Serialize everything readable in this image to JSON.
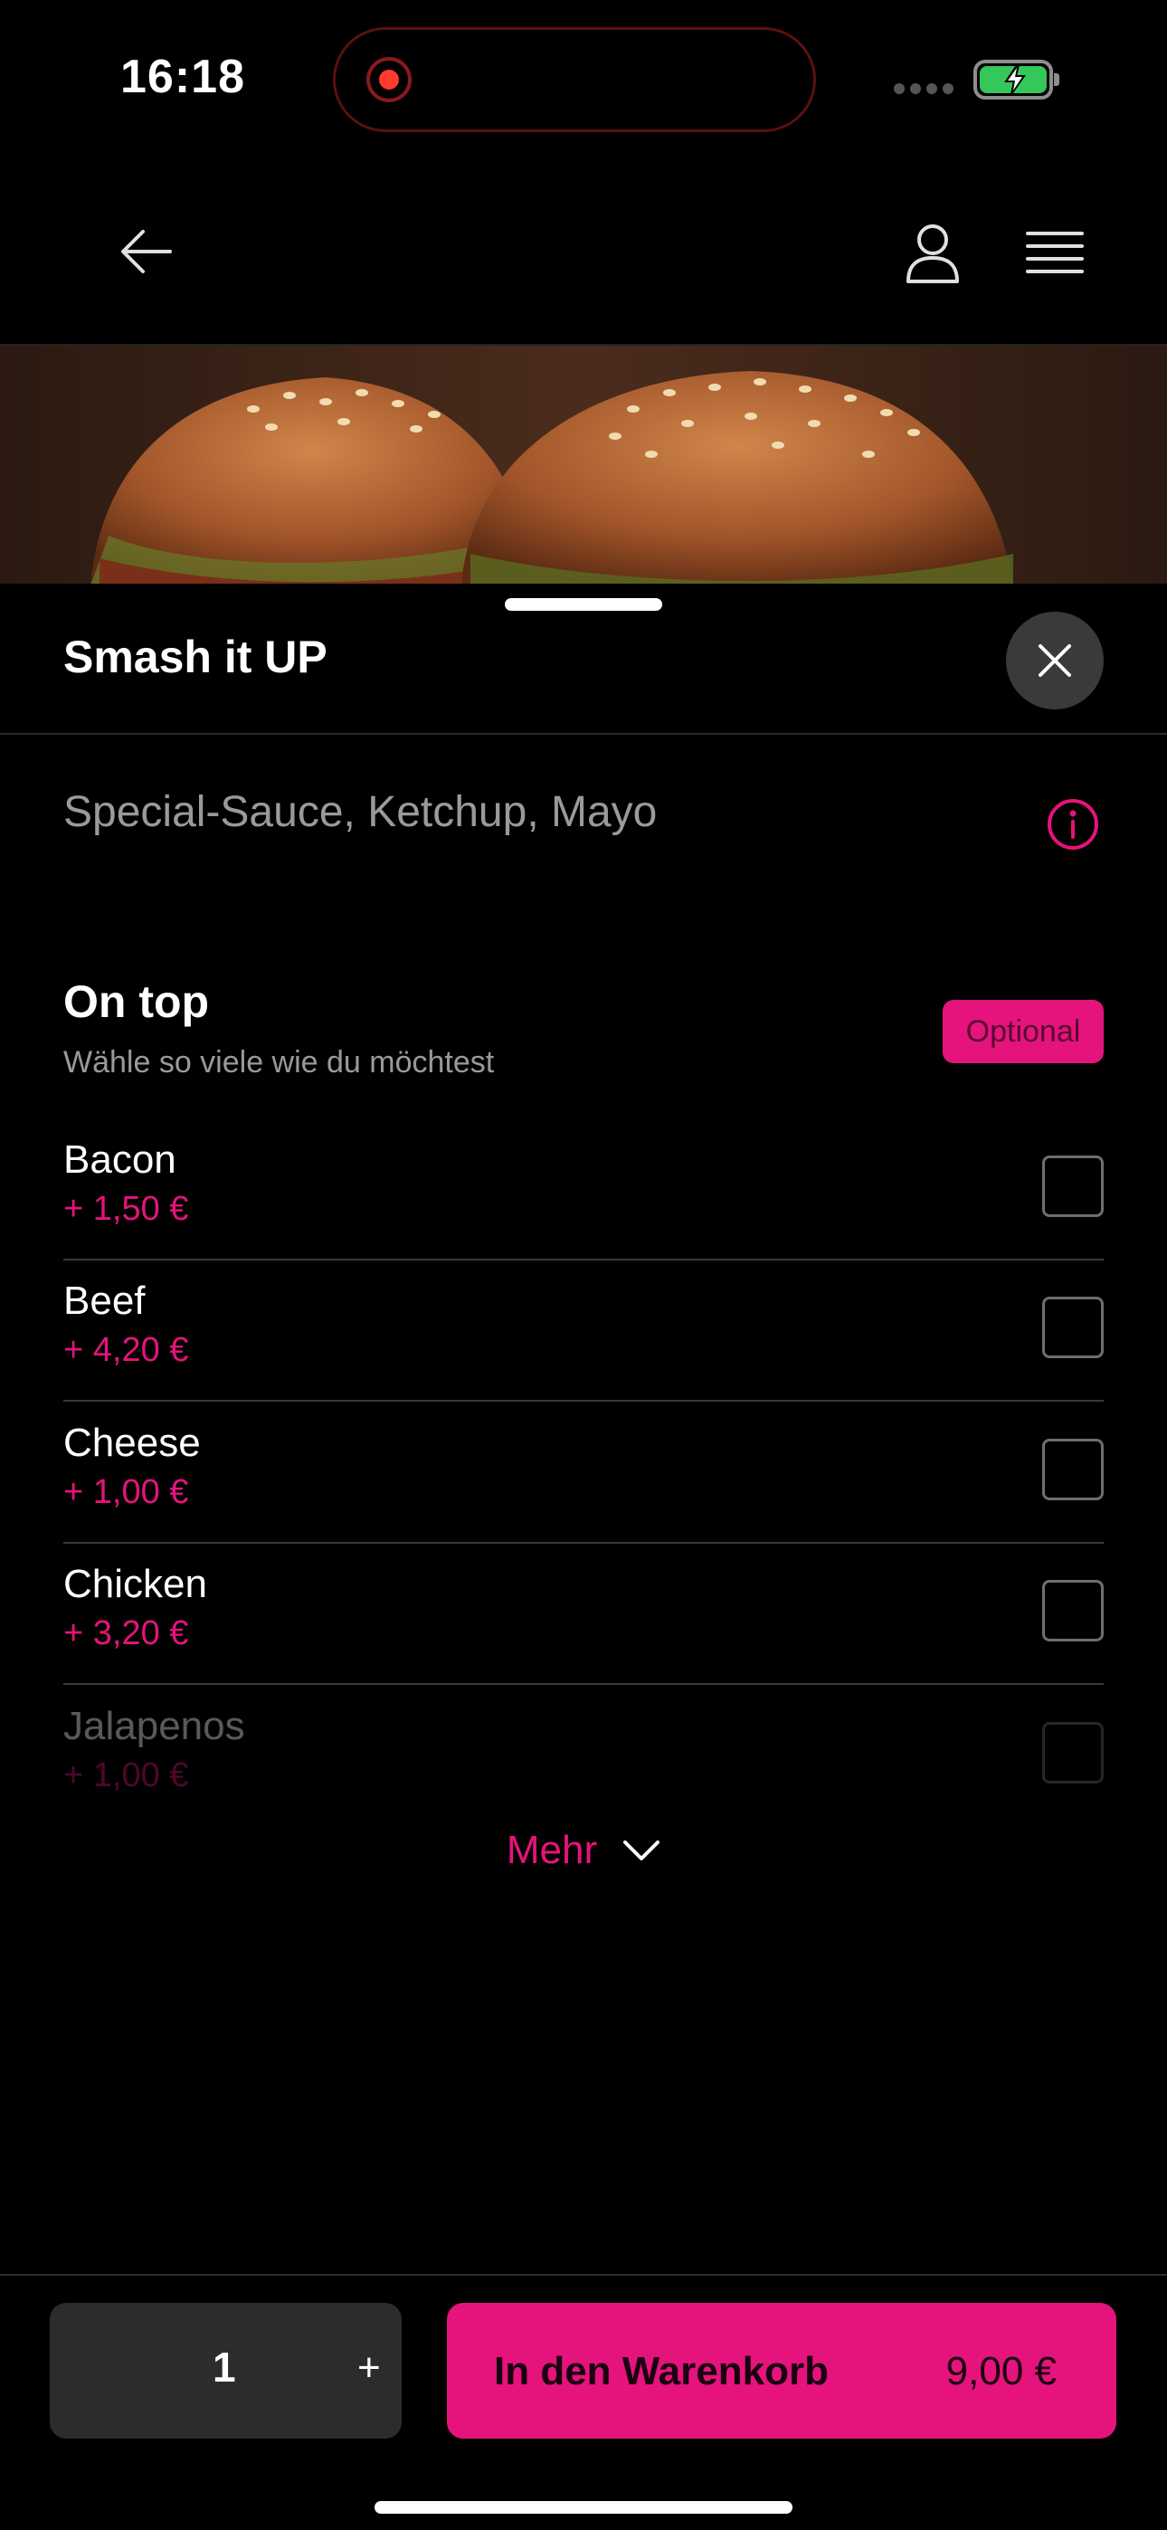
{
  "status_bar": {
    "time": "16:18",
    "recording_color": "#ff3b30",
    "battery_color": "#34c759"
  },
  "header": {
    "back_icon": "arrow-left-icon",
    "account_icon": "user-icon",
    "menu_icon": "hamburger-menu-icon"
  },
  "product": {
    "name": "Smash it UP",
    "description": "Special-Sauce, Ketchup, Mayo",
    "info_icon": "info-icon",
    "close_icon": "close-icon"
  },
  "option_group": {
    "title": "On top",
    "subtitle": "Wähle so viele wie du möchtest",
    "badge": "Optional",
    "items": [
      {
        "name": "Bacon",
        "price": "+ 1,50 €",
        "checked": false
      },
      {
        "name": "Beef",
        "price": "+ 4,20 €",
        "checked": false
      },
      {
        "name": "Cheese",
        "price": "+ 1,00 €",
        "checked": false
      },
      {
        "name": "Chicken",
        "price": "+ 3,20 €",
        "checked": false
      },
      {
        "name": "Jalapenos",
        "price": "+ 1,00 €",
        "checked": false
      }
    ],
    "more_label": "Mehr"
  },
  "footer": {
    "quantity": "1",
    "plus_label": "+",
    "add_to_cart_label": "In den Warenkorb",
    "total_price": "9,00 €"
  },
  "colors": {
    "accent": "#e5137c",
    "background": "#000000",
    "surface": "#2c2c2e"
  }
}
